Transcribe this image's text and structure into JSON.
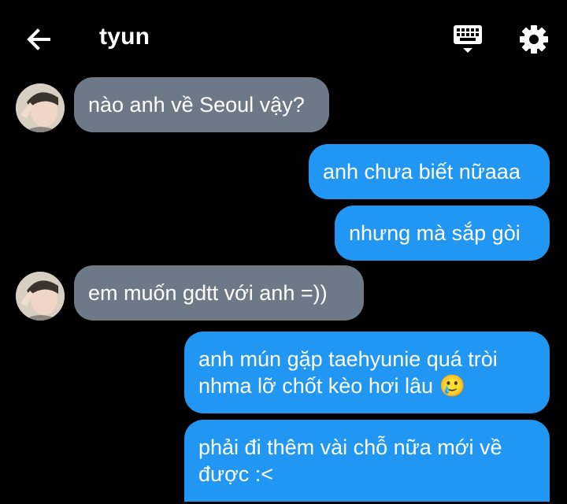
{
  "header": {
    "title": "tyun",
    "back_icon": "arrow-left-icon",
    "keyboard_icon": "keyboard-icon",
    "settings_icon": "gear-icon"
  },
  "colors": {
    "background": "#000000",
    "incoming_bubble": "#6d7987",
    "outgoing_bubble": "#2196f3"
  },
  "messages": [
    {
      "direction": "incoming",
      "text": "nào anh về Seoul vậy?"
    },
    {
      "direction": "outgoing",
      "text": "anh chưa biết nữaaa"
    },
    {
      "direction": "outgoing",
      "text": "nhưng mà sắp gòi"
    },
    {
      "direction": "incoming",
      "text": "em muốn gdtt với anh =))"
    },
    {
      "direction": "outgoing",
      "text": "anh mún gặp taehyunie quá tròi\nnhma lỡ chốt kèo hơi lâu 🥲"
    },
    {
      "direction": "outgoing",
      "text": "phải đi thêm vài chỗ nữa mới về\nđược :<"
    }
  ]
}
